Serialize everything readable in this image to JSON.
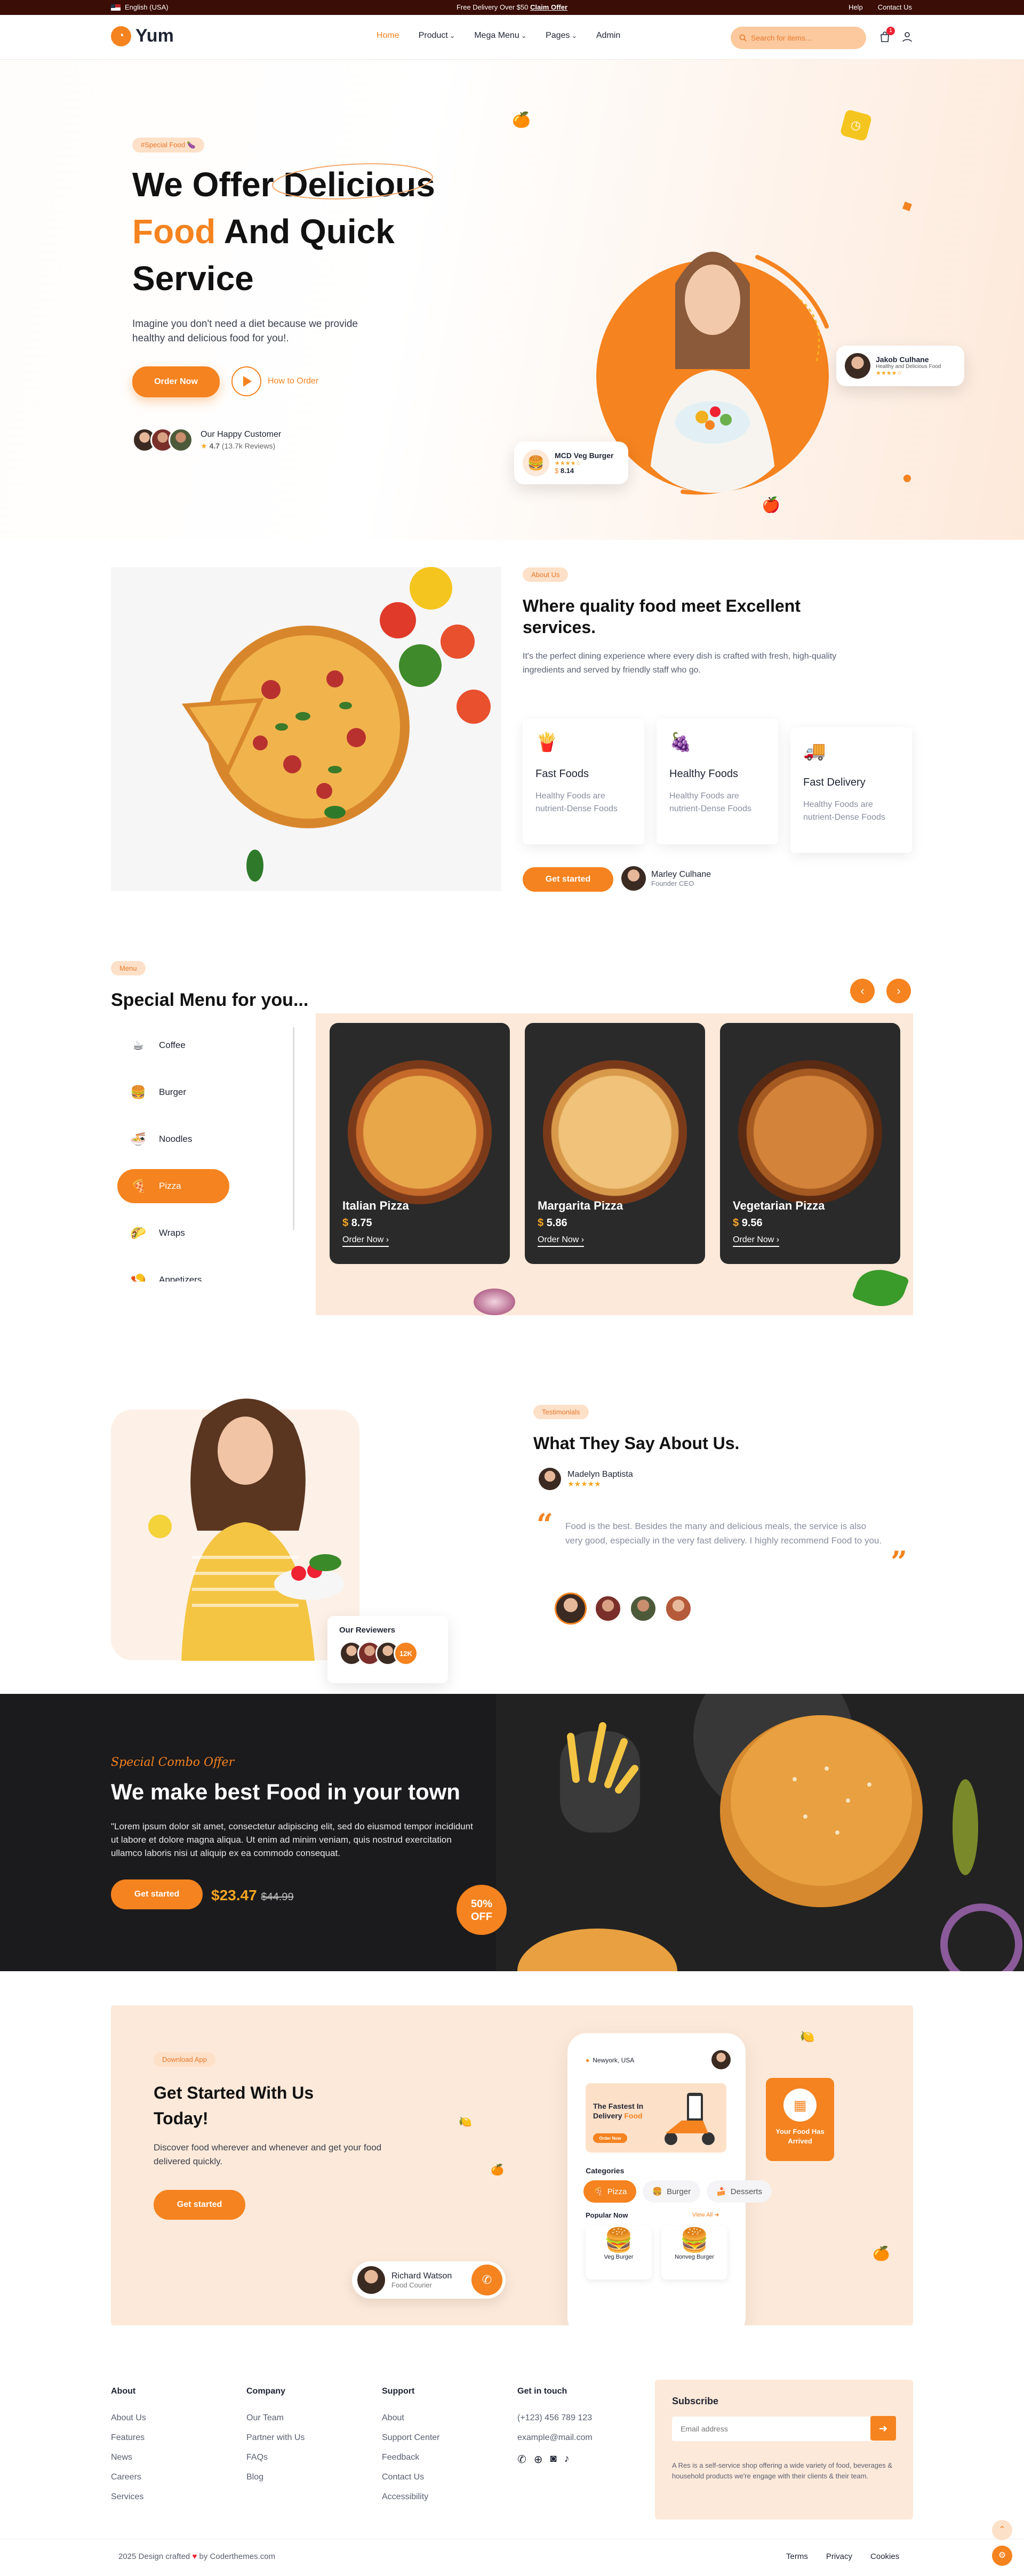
{
  "topbar": {
    "language": "English (USA)",
    "promo_text": "Free Delivery Over $50",
    "promo_link": "Claim Offer",
    "help": "Help",
    "contact": "Contact Us"
  },
  "header": {
    "brand": "Yum",
    "nav": [
      "Home",
      "Product",
      "Mega Menu",
      "Pages",
      "Admin"
    ],
    "search_placeholder": "Search for items...",
    "cart_count": "1"
  },
  "hero": {
    "badge": "#Special Food",
    "title_line1": "We Offer Delicious",
    "title_food": "Food",
    "title_rest": " And Quick",
    "title_line3": "Service",
    "description": "Imagine you don't need a diet because we provide healthy and delicious food for you!.",
    "order_button": "Order Now",
    "how_link": "How to Order",
    "happy_title": "Our Happy Customer",
    "rating": "4.7",
    "reviews": "(13.7k Reviews)",
    "review_card": {
      "name": "Jakob Culhane",
      "sub": "Healthy and Delicious Food",
      "stars": "★★★★☆"
    },
    "burger_card": {
      "name": "MCD Veg Burger",
      "stars": "★★★★☆",
      "currency": "$",
      "price": "8.14"
    }
  },
  "about": {
    "badge": "About Us",
    "title": "Where quality food meet Excellent services.",
    "text": "It's the perfect dining experience where every dish is crafted with fresh, high-quality ingredients and served by friendly staff who go.",
    "features": [
      {
        "title": "Fast Foods",
        "desc": "Healthy Foods are nutrient-Dense Foods",
        "icon": "🍟"
      },
      {
        "title": "Healthy Foods",
        "desc": "Healthy Foods are nutrient-Dense Foods",
        "icon": "🍇"
      },
      {
        "title": "Fast Delivery",
        "desc": "Healthy Foods are nutrient-Dense Foods",
        "icon": "🚚"
      }
    ],
    "button": "Get started",
    "founder_name": "Marley Culhane",
    "founder_role": "Founder CEO"
  },
  "menu": {
    "badge": "Menu",
    "title": "Special Menu for you...",
    "categories": [
      {
        "label": "Coffee",
        "icon": "☕"
      },
      {
        "label": "Burger",
        "icon": "🍔"
      },
      {
        "label": "Noodles",
        "icon": "🍜"
      },
      {
        "label": "Pizza",
        "icon": "🍕"
      },
      {
        "label": "Wraps",
        "icon": "🌮"
      },
      {
        "label": "Appetizers",
        "icon": "🍤"
      }
    ],
    "items": [
      {
        "name": "Italian Pizza",
        "currency": "$",
        "price": "8.75",
        "action": "Order Now ›"
      },
      {
        "name": "Margarita Pizza",
        "currency": "$",
        "price": "5.86",
        "action": "Order Now ›"
      },
      {
        "name": "Vegetarian Pizza",
        "currency": "$",
        "price": "9.56",
        "action": "Order Now ›"
      }
    ]
  },
  "testimonials": {
    "badge": "Testimonials",
    "title": "What They Say About Us.",
    "author": "Madelyn Baptista",
    "stars": "★★★★★",
    "quote": "Food is the best. Besides the many and delicious meals, the service is also very good, especially in the very fast delivery. I highly recommend Food to you.",
    "reviewers_title": "Our Reviewers",
    "reviewers_count": "12K"
  },
  "combo": {
    "tag": "Special Combo Offer",
    "title": "We make best Food in your town",
    "text": "\"Lorem ipsum dolor sit amet, consectetur adipiscing elit, sed do eiusmod tempor incididunt ut labore et dolore magna aliqua. Ut enim ad minim veniam, quis nostrud exercitation ullamco laboris nisi ut aliquip ex ea commodo consequat.",
    "button": "Get started",
    "price": "$23.47",
    "old_price": "$44.99",
    "discount": "50%",
    "discount_label": "OFF"
  },
  "download": {
    "badge": "Download App",
    "title": "Get Started With Us Today!",
    "text": "Discover food wherever and whenever and get your food delivered quickly.",
    "button": "Get started",
    "courier_name": "Richard Watson",
    "courier_role": "Food Courier",
    "phone": {
      "location": "Newyork, USA",
      "banner_title": "The Fastest In Delivery",
      "banner_accent": "Food",
      "banner_button": "Order Now",
      "categories_title": "Categories",
      "categories": [
        {
          "label": "Pizza",
          "icon": "🍕"
        },
        {
          "label": "Burger",
          "icon": "🍔"
        },
        {
          "label": "Desserts",
          "icon": "🍰"
        }
      ],
      "popular_title": "Popular Now",
      "view_all": "View All",
      "popular": [
        "Veg Burger",
        "Nonveg Burger"
      ]
    },
    "arrived_badge": "Your Food Has Arrived"
  },
  "footer": {
    "columns": [
      {
        "title": "About",
        "links": [
          "About Us",
          "Features",
          "News",
          "Careers",
          "Services"
        ]
      },
      {
        "title": "Company",
        "links": [
          "Our Team",
          "Partner with Us",
          "FAQs",
          "Blog"
        ]
      },
      {
        "title": "Support",
        "links": [
          "About",
          "Support Center",
          "Feedback",
          "Contact Us",
          "Accessibility"
        ]
      }
    ],
    "contact_title": "Get in touch",
    "phone": "(+123) 456 789 123",
    "email": "example@mail.com",
    "subscribe_title": "Subscribe",
    "subscribe_placeholder": "Email address",
    "subscribe_text": "A Res is a self-service shop offering a wide variety of food, beverages & household products we're engage with their clients & their team.",
    "copyright_prefix": "2025 Design crafted",
    "copyright_suffix": "by Coderthemes.com",
    "bottom_links": [
      "Terms",
      "Privacy",
      "Cookies"
    ]
  },
  "colors": {
    "accent": "#f5831f",
    "dark": "#3a0d06",
    "peach": "#fde9d9"
  }
}
